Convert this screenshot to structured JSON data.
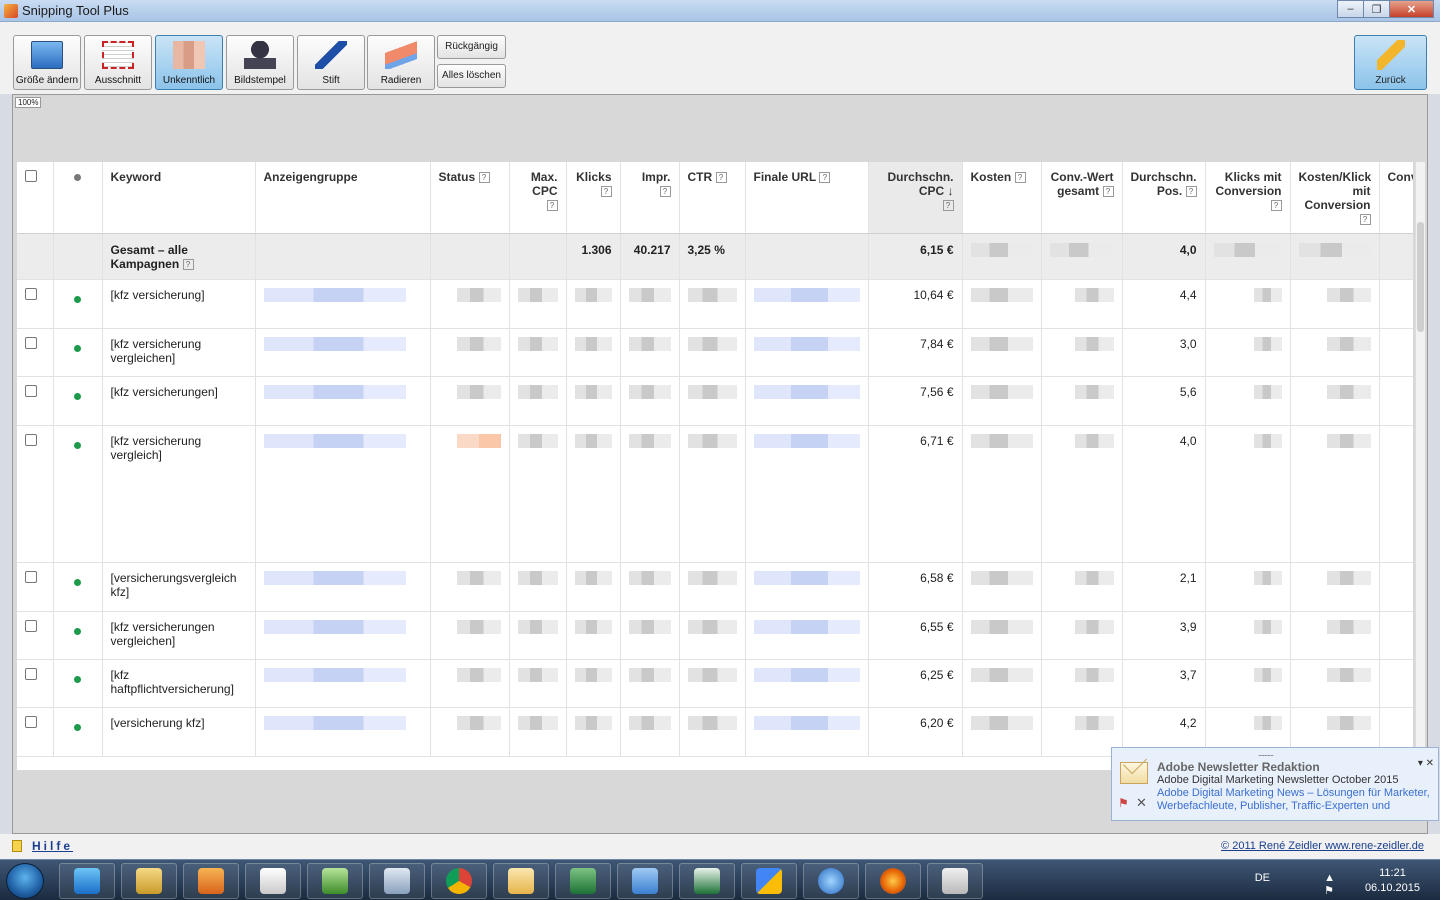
{
  "window": {
    "title": "Snipping Tool Plus",
    "controls": [
      "–",
      "❐",
      "✕"
    ]
  },
  "toolbar": {
    "tools": [
      {
        "label": "Größe ändern",
        "icon": "resize-icon",
        "active": false
      },
      {
        "label": "Ausschnitt",
        "icon": "crop-icon",
        "active": false
      },
      {
        "label": "Unkenntlich",
        "icon": "pixelate-icon",
        "active": true
      },
      {
        "label": "Bildstempel",
        "icon": "stamp-icon",
        "active": false
      },
      {
        "label": "Stift",
        "icon": "pen-icon",
        "active": false
      },
      {
        "label": "Radieren",
        "icon": "eraser-icon",
        "active": false
      }
    ],
    "undo_label": "Rückgängig",
    "clear_label": "Alles löschen",
    "back_label": "Zurück"
  },
  "canvas": {
    "zoom": "100%"
  },
  "table": {
    "columns": [
      {
        "label": "",
        "align": "left"
      },
      {
        "label": "",
        "align": "left"
      },
      {
        "label": "Keyword",
        "align": "left"
      },
      {
        "label": "Anzeigengruppe",
        "align": "left"
      },
      {
        "label": "Status",
        "align": "left",
        "help": "?"
      },
      {
        "label": "Max. CPC",
        "align": "right",
        "help": "?"
      },
      {
        "label": "Klicks",
        "align": "right",
        "help": "?"
      },
      {
        "label": "Impr.",
        "align": "right",
        "help": "?"
      },
      {
        "label": "CTR",
        "align": "left",
        "help": "?"
      },
      {
        "label": "Finale URL",
        "align": "left",
        "help": "?"
      },
      {
        "label": "Durchschn. CPC",
        "align": "right",
        "help": "?",
        "sort": "↓"
      },
      {
        "label": "Kosten",
        "align": "left",
        "help": "?"
      },
      {
        "label": "Conv.-Wert gesamt",
        "align": "right",
        "help": "?"
      },
      {
        "label": "Durchschn. Pos.",
        "align": "right",
        "help": "?"
      },
      {
        "label": "Klicks mit Conversion",
        "align": "right",
        "help": "?"
      },
      {
        "label": "Kosten/Klick mit Conversion",
        "align": "right",
        "help": "?"
      },
      {
        "label": "Conv",
        "align": "left"
      }
    ],
    "total": {
      "label": "Gesamt – alle Kampagnen",
      "help": "?",
      "clicks": "1.306",
      "impressions": "40.217",
      "ctr": "3,25 %",
      "avg_cpc": "6,15 €",
      "avg_pos": "4,0"
    },
    "rows": [
      {
        "keyword": "[kfz versicherung]",
        "avg_cpc": "10,64 €",
        "avg_pos": "4,4"
      },
      {
        "keyword": "[kfz versicherung vergleichen]",
        "avg_cpc": "7,84 €",
        "avg_pos": "3,0"
      },
      {
        "keyword": "[kfz versicherungen]",
        "avg_cpc": "7,56 €",
        "avg_pos": "5,6"
      },
      {
        "keyword": "[kfz versicherung vergleich]",
        "avg_cpc": "6,71 €",
        "avg_pos": "4,0"
      },
      {
        "keyword": "[versicherungsvergleich kfz]",
        "avg_cpc": "6,58 €",
        "avg_pos": "2,1"
      },
      {
        "keyword": "[kfz versicherungen vergleichen]",
        "avg_cpc": "6,55 €",
        "avg_pos": "3,9"
      },
      {
        "keyword": "[kfz haftpflichtversicherung]",
        "avg_cpc": "6,25 €",
        "avg_pos": "3,7"
      },
      {
        "keyword": "[versicherung kfz]",
        "avg_cpc": "6,20 €",
        "avg_pos": "4,2"
      }
    ]
  },
  "notification": {
    "grip": "..........",
    "from": "Adobe Newsletter Redaktion",
    "subject": "Adobe Digital Marketing Newsletter October 2015",
    "body": "Adobe Digital Marketing News – Lösungen für Marketer, Werbefachleute, Publisher, Traffic-Experten und",
    "controls": "▾ ✕"
  },
  "footer": {
    "help": "Hilfe",
    "copyright": "© 2011 René Zeidler www.rene-zeidler.de"
  },
  "taskbar": {
    "apps": [
      "internet-explorer-icon",
      "file-explorer-icon",
      "media-player-icon",
      "notepad-icon",
      "notepad-plus-icon",
      "calculator-icon",
      "chrome-icon",
      "outlook-icon",
      "excel-icon",
      "paint-icon",
      "excel-file-icon",
      "adwords-icon",
      "itunes-icon",
      "firefox-icon",
      "snipping-tool-icon"
    ],
    "lang": "DE",
    "tray_icons": "▲ ⚑ ◀",
    "time": "11:21",
    "date": "06.10.2015"
  }
}
